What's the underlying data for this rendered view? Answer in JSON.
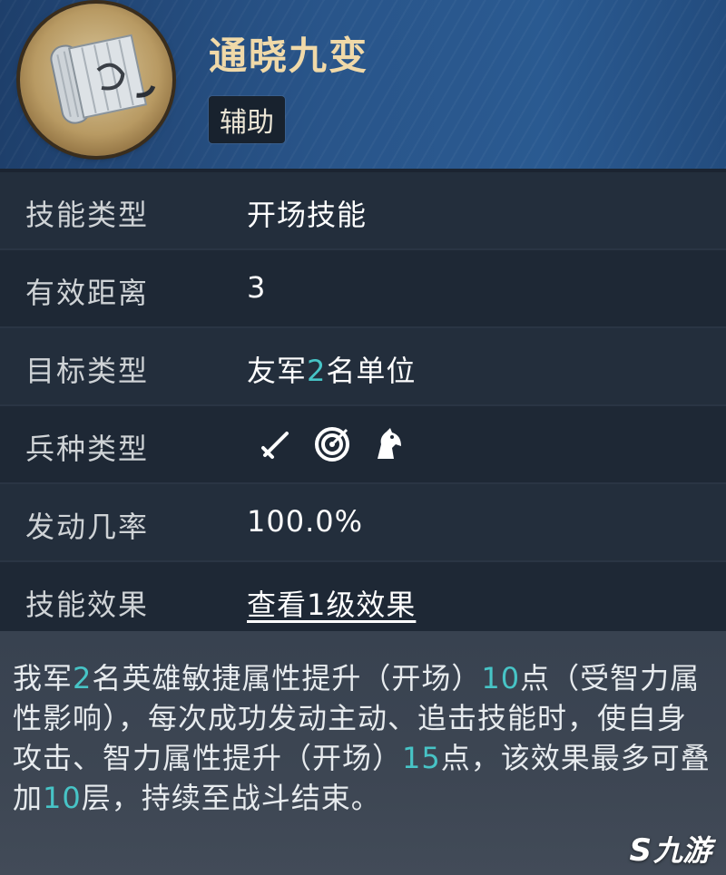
{
  "header": {
    "skill_name": "通晓九变",
    "tag": "辅助"
  },
  "rows": [
    {
      "label": "技能类型",
      "value": "开场技能"
    },
    {
      "label": "有效距离",
      "value": "3"
    },
    {
      "label": "目标类型",
      "value_pre": "友军",
      "value_num": "2",
      "value_post": "名单位"
    },
    {
      "label": "兵种类型",
      "icons": [
        "sword-icon",
        "target-icon",
        "horse-icon"
      ]
    },
    {
      "label": "发动几率",
      "value": "100.0%"
    },
    {
      "label": "技能效果",
      "link": "查看1级效果"
    }
  ],
  "description": {
    "p1": "我军",
    "n1": "2",
    "p2": "名英雄敏捷属性提升（开场）",
    "n2": "10",
    "p3": "点（受智力属性影响），每次成功发动主动、追击技能时，使自身攻击、智力属性提升（开场）",
    "n3": "15",
    "p4": "点，该效果最多可叠加",
    "n4": "10",
    "p5": "层，持续至战斗结束。"
  },
  "watermark": {
    "symbol": "S",
    "text": "九游"
  },
  "colors": {
    "accent": "#47c4c6",
    "title": "#f0d9a8"
  }
}
